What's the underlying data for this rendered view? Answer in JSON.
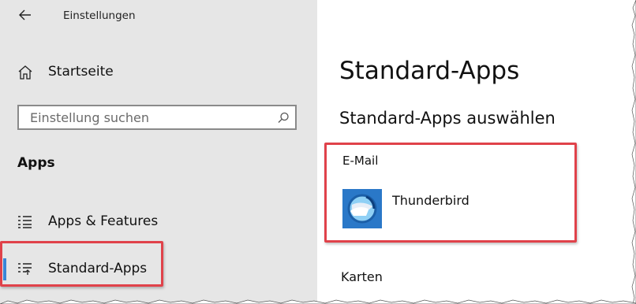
{
  "window": {
    "title": "Einstellungen"
  },
  "sidebar": {
    "home_label": "Startseite",
    "search": {
      "placeholder": "Einstellung suchen"
    },
    "section_title": "Apps",
    "items": [
      {
        "label": "Apps & Features",
        "icon": "list-icon"
      },
      {
        "label": "Standard-Apps",
        "icon": "default-apps-icon",
        "active": true
      }
    ]
  },
  "main": {
    "page_title": "Standard-Apps",
    "subtitle": "Standard-Apps auswählen",
    "categories": [
      {
        "label": "E-Mail",
        "app_name": "Thunderbird"
      },
      {
        "label": "Karten"
      }
    ]
  },
  "colors": {
    "accent": "#3a86d6",
    "highlight": "#e0424a",
    "sidebar_bg": "#e6e6e6"
  }
}
